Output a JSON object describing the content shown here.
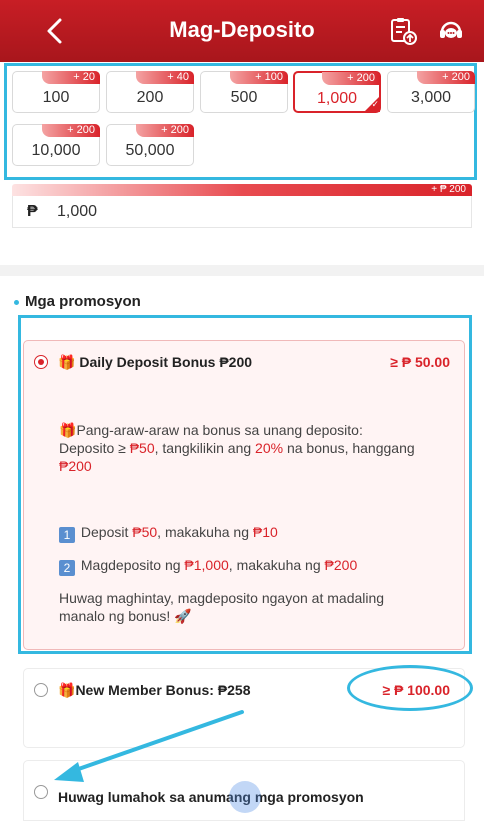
{
  "header": {
    "title": "Mag-Deposito",
    "icons": [
      "back-icon",
      "deposit-record-icon",
      "customer-service-icon"
    ]
  },
  "amounts": [
    {
      "value": "100",
      "bonus": "+ 20",
      "selected": false
    },
    {
      "value": "200",
      "bonus": "+ 40",
      "selected": false
    },
    {
      "value": "500",
      "bonus": "+ 100",
      "selected": false
    },
    {
      "value": "1,000",
      "bonus": "+ 200",
      "selected": true
    },
    {
      "value": "3,000",
      "bonus": "+ 200",
      "selected": false
    },
    {
      "value": "10,000",
      "bonus": "+ 200",
      "selected": false
    },
    {
      "value": "50,000",
      "bonus": "+ 200",
      "selected": false
    }
  ],
  "amount_input": {
    "bonus_tag": "+ ₱ 200",
    "currency": "₱",
    "value": "1,000"
  },
  "promotions": {
    "section_title": "Mga promosyon",
    "daily": {
      "title": "Daily Deposit Bonus ₱200",
      "min": "≥ ₱ 50.00",
      "line1_a": "Pang-araw-araw na bonus sa unang deposito:",
      "line2_a": "Deposito ≥ ",
      "line2_b": "₱50",
      "line2_c": ", tangkilikin ang ",
      "line2_d": "20%",
      "line2_e": " na bonus, hanggang",
      "line3": "₱200",
      "n1": "1",
      "item1_a": "Deposit ",
      "item1_b": "₱50",
      "item1_c": ", makakuha ng ",
      "item1_d": "₱10",
      "n2": "2",
      "item2_a": "Magdeposito ng ",
      "item2_b": "₱1,000",
      "item2_c": ", makakuha ng ",
      "item2_d": "₱200",
      "closing1": "Huwag maghintay, magdeposito ngayon at madaling",
      "closing2": "manalo ng bonus! 🚀"
    },
    "new_member": {
      "title": "New Member Bonus: ₱258",
      "min": "≥ ₱ 100.00"
    },
    "none": {
      "title": "Huwag lumahok sa anumang mga promosyon"
    }
  },
  "colors": {
    "brand": "#c81e25",
    "accent": "#d9232a",
    "annotation": "#34b8e0"
  }
}
